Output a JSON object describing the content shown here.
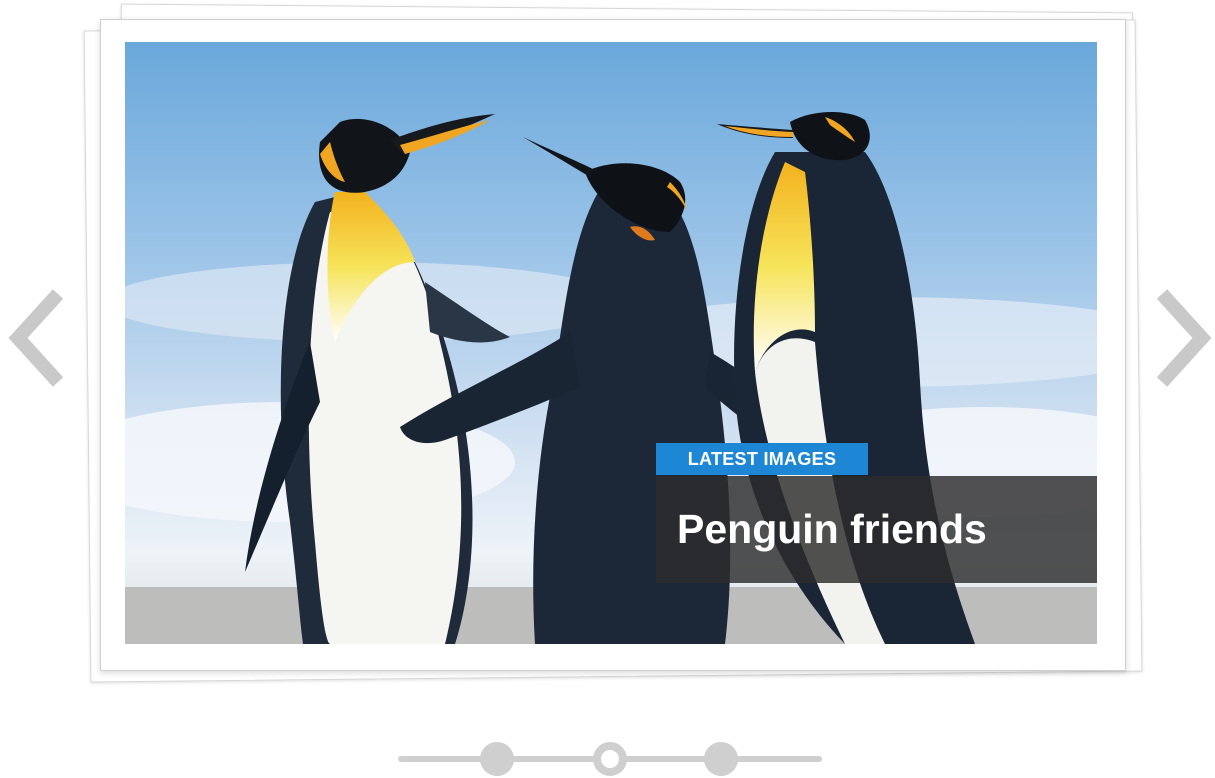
{
  "slider": {
    "category_label": "LATEST IMAGES",
    "caption_title": "Penguin friends",
    "active_slide": 2,
    "slide_count": 3
  },
  "icons": {
    "prev": "chevron-left-icon",
    "next": "chevron-right-icon"
  },
  "colors": {
    "accent": "#1d87d6",
    "caption_background": "#2c2c2c",
    "arrow": "#c9c9c9",
    "pager": "#cfcfcf"
  }
}
